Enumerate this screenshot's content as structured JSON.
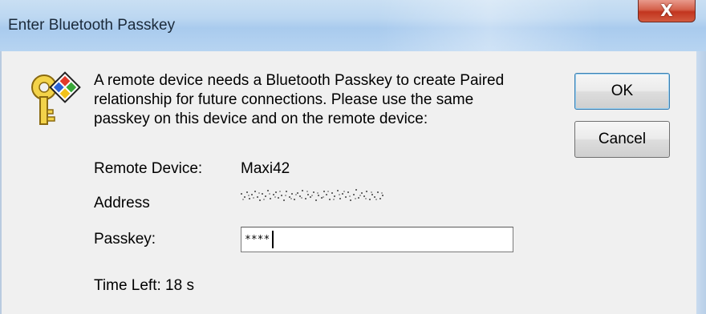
{
  "window": {
    "title": "Enter Bluetooth Passkey",
    "close_glyph": "X"
  },
  "message": {
    "lines": [
      "A remote device needs a Bluetooth Passkey to create Paired",
      "relationship for future connections. Please use the same",
      "passkey on this device and on the remote device:"
    ]
  },
  "buttons": {
    "ok_label": "OK",
    "cancel_label": "Cancel"
  },
  "fields": {
    "remote_device_label": "Remote Device:",
    "remote_device_value": "Maxi42",
    "address_label": "Address",
    "passkey_label": "Passkey:",
    "passkey_value": "****"
  },
  "status": {
    "time_left": "Time Left: 18 s"
  },
  "icons": {
    "dialog_icon": "key-icon",
    "close": "close-icon"
  },
  "colors": {
    "titlebar": "#bcd7f1",
    "close_button": "#c2351f",
    "dialog_background": "#f0f0f0"
  }
}
